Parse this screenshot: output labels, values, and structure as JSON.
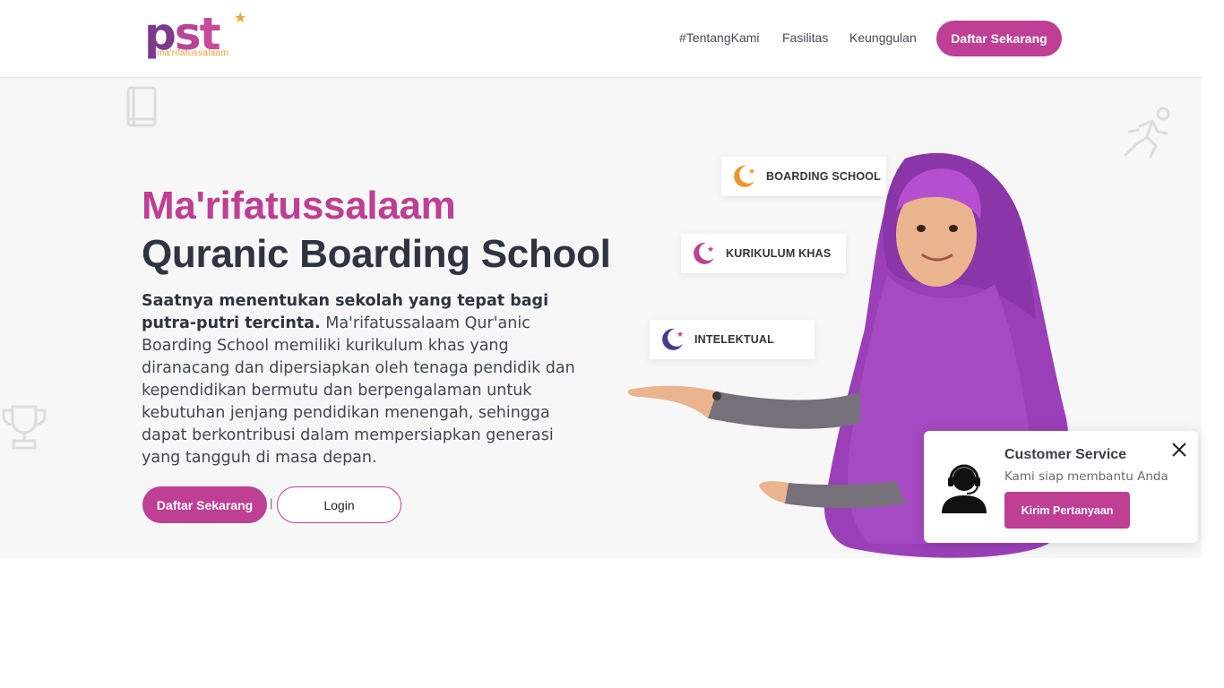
{
  "header": {
    "logo": {
      "mark": [
        "p",
        "s",
        "t"
      ],
      "tagline": "ma'rifatussalaam"
    },
    "nav": [
      {
        "label": "#TentangKami"
      },
      {
        "label": "Fasilitas"
      },
      {
        "label": "Keunggulan"
      }
    ],
    "cta_label": "Daftar Sekarang"
  },
  "hero": {
    "title_line1": "Ma'rifatussalaam",
    "title_line2": "Quranic Boarding School",
    "description_bold": "Saatnya menentukan sekolah yang tepat bagi putra-putri tercinta.",
    "description": "Ma'rifatussalaam Qur'anic Boarding School memiliki kurikulum khas yang diranacang dan dipersiapkan oleh tenaga pendidik dan kependidikan bermutu dan berpengalaman untuk kebutuhan jenjang pendidikan menengah, sehingga dapat berkontribusi dalam mempersiapkan generasi yang tangguh di masa depan.",
    "cta_label": "Daftar Sekarang",
    "separator": "|",
    "login_label": "Login",
    "badges": [
      {
        "label": "BOARDING SCHOOL",
        "icon": "moon-star-icon",
        "color": "#f0932b"
      },
      {
        "label": "KURIKULUM KHAS",
        "icon": "moon-star-icon",
        "color": "#be3f93"
      },
      {
        "label": "INTELEKTUAL",
        "icon": "moon-star-icon",
        "color": "#4a3a8c"
      }
    ],
    "decorative_icons": [
      "book-icon",
      "running-icon",
      "trophy-icon"
    ]
  },
  "customer_service": {
    "title": "Customer Service",
    "subtitle": "Kami siap membantu Anda",
    "button_label": "Kirim Pertanyaan",
    "icon": "headset-agent-icon"
  },
  "colors": {
    "brand": "#be3f93",
    "dark": "#2e3440",
    "hero_bg": "#f7f7f8",
    "accent_orange": "#f0932b"
  }
}
